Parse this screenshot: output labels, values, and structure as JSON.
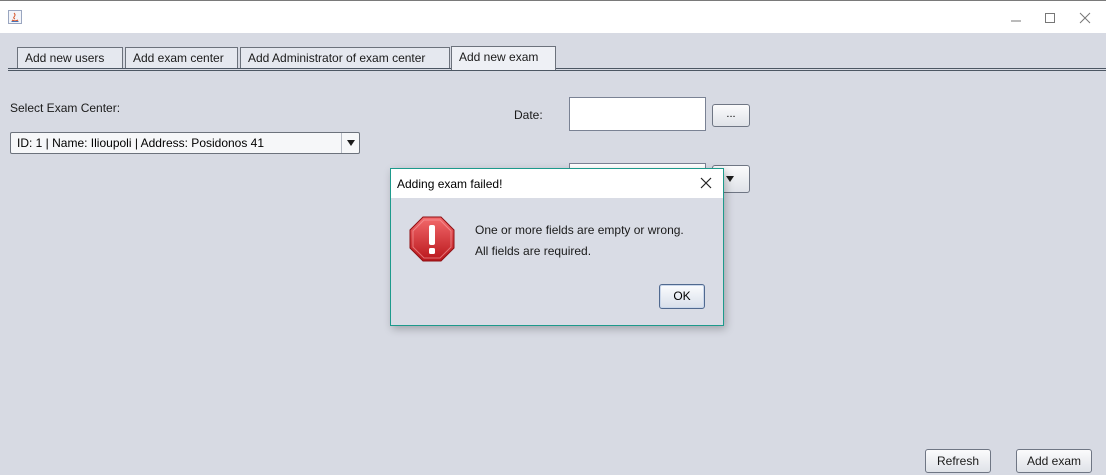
{
  "tabs": [
    {
      "label": "Add new users"
    },
    {
      "label": "Add exam center"
    },
    {
      "label": "Add Administrator of exam center"
    },
    {
      "label": "Add new exam",
      "active": true
    }
  ],
  "form": {
    "exam_center_label": "Select Exam Center:",
    "exam_center_selected": "ID: 1 | Name: Ilioupoli | Address: Posidonos 41",
    "date_label": "Date:",
    "date_value": "",
    "date_picker_label": "..."
  },
  "buttons": {
    "refresh": "Refresh",
    "add_exam": "Add exam"
  },
  "dialog": {
    "title": "Adding exam failed!",
    "line1": "One or more fields are empty or wrong.",
    "line2": "All fields are required.",
    "ok": "OK",
    "icon": "error-stop-icon"
  },
  "icons": {
    "app": "java-app-icon",
    "minimize": "minimize-icon",
    "maximize": "maximize-icon",
    "close": "close-icon"
  },
  "colors": {
    "background": "#d7dae3",
    "dialog_border": "#1d9a8c",
    "error_red": "#d8262a"
  }
}
